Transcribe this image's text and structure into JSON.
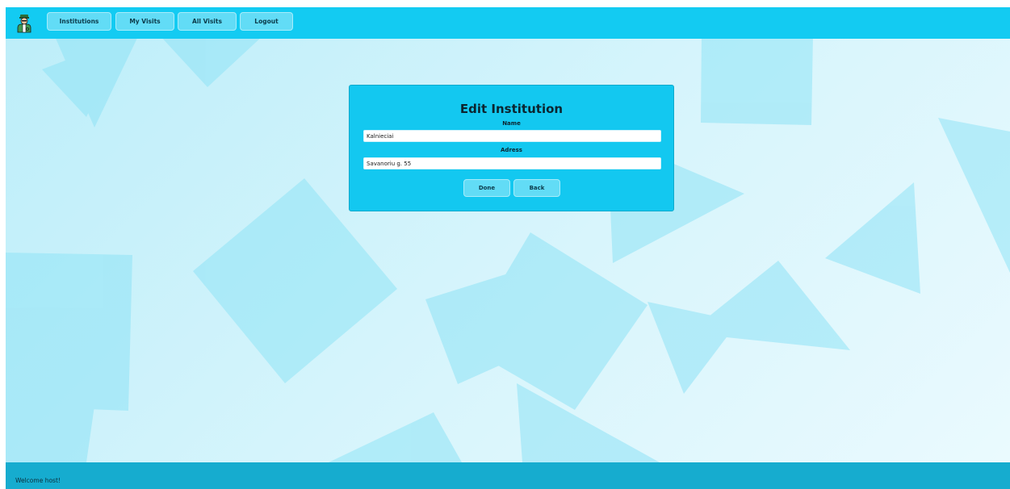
{
  "nav": {
    "logo_icon": "doctor-icon",
    "items": [
      {
        "label": "Institutions"
      },
      {
        "label": "My Visits"
      },
      {
        "label": "All Visits"
      },
      {
        "label": "Logout"
      }
    ]
  },
  "form": {
    "title": "Edit Institution",
    "name_label": "Name",
    "name_value": "Kalnieciai",
    "address_label": "Adress",
    "address_value": "Savanoriu g. 55",
    "done_label": "Done",
    "back_label": "Back"
  },
  "footer": {
    "text": "Welcome host!"
  },
  "colors": {
    "header": "#13cbf2",
    "card": "#13c8f0",
    "footer": "#16accf",
    "button": "#62dcf6"
  }
}
